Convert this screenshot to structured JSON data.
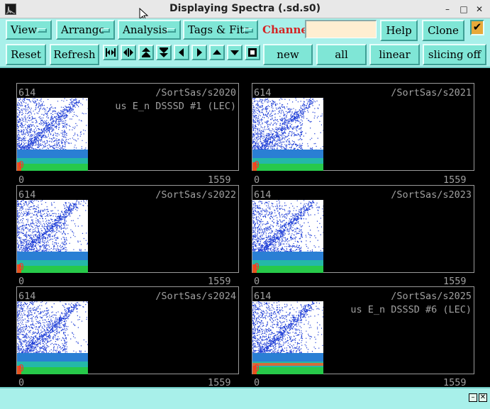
{
  "window": {
    "title": "Displaying Spectra (.sd.s0)",
    "minimize_glyph": "–",
    "maximize_glyph": "□",
    "close_glyph": "✕"
  },
  "toolbar": {
    "menus": [
      {
        "label": "View"
      },
      {
        "label": "Arrange"
      },
      {
        "label": "Analysis"
      },
      {
        "label": "Tags & Fits"
      }
    ],
    "channel_label": "Channel:",
    "channel_value": "",
    "help_label": "Help",
    "clone_label": "Clone",
    "checkbox_glyph": "✔",
    "reset_label": "Reset",
    "refresh_label": "Refresh",
    "new_label": "new",
    "all_label": "all",
    "linear_label": "linear",
    "slicing_label": "slicing off",
    "nav_icons": [
      "shrink-horizontal-icon",
      "expand-horizontal-icon",
      "expand-vertical-icon",
      "shrink-vertical-icon",
      "arrow-left-icon",
      "arrow-right-icon",
      "arrow-up-icon",
      "arrow-down-icon",
      "full-view-icon"
    ]
  },
  "panels": [
    {
      "ymax": "614",
      "path": "/SortSas/s2020",
      "subtitle": "us E_n DSSSD #1 (LEC)",
      "xmin": "0",
      "xmax": "1559",
      "ymin": "0"
    },
    {
      "ymax": "614",
      "path": "/SortSas/s2021",
      "subtitle": "",
      "xmin": "0",
      "xmax": "1559",
      "ymin": "0"
    },
    {
      "ymax": "614",
      "path": "/SortSas/s2022",
      "subtitle": "",
      "xmin": "0",
      "xmax": "1559",
      "ymin": "0"
    },
    {
      "ymax": "614",
      "path": "/SortSas/s2023",
      "subtitle": "",
      "xmin": "0",
      "xmax": "1559",
      "ymin": "0"
    },
    {
      "ymax": "614",
      "path": "/SortSas/s2024",
      "subtitle": "",
      "xmin": "0",
      "xmax": "1559",
      "ymin": "0"
    },
    {
      "ymax": "614",
      "path": "/SortSas/s2025",
      "subtitle": "us E_n DSSSD #6 (LEC)",
      "xmin": "0",
      "xmax": "1559",
      "ymin": "0"
    }
  ],
  "statusbar": {
    "min_glyph": "–",
    "close_glyph": "✕"
  },
  "colors": {
    "toolbar_bg": "#a8f0ea",
    "button_bg": "#7fe6d6",
    "channel_label": "#d42323",
    "channel_field": "#ffeed1",
    "checkbox": "#e8a93a"
  }
}
